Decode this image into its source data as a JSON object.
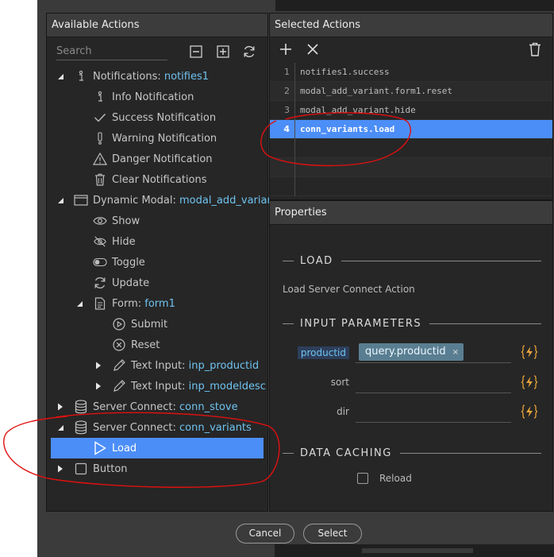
{
  "available": {
    "title": "Available Actions",
    "search_placeholder": "Search",
    "tree": [
      {
        "level": 0,
        "arrow": "down",
        "icon": "info-icon",
        "label": "Notifications: ",
        "value": "notifies1"
      },
      {
        "level": 1,
        "arrow": "none",
        "icon": "info-icon",
        "label": "Info Notification",
        "value": ""
      },
      {
        "level": 1,
        "arrow": "none",
        "icon": "check-icon",
        "label": "Success Notification",
        "value": ""
      },
      {
        "level": 1,
        "arrow": "none",
        "icon": "exclamation-icon",
        "label": "Warning Notification",
        "value": ""
      },
      {
        "level": 1,
        "arrow": "none",
        "icon": "warning-triangle-icon",
        "label": "Danger Notification",
        "value": ""
      },
      {
        "level": 1,
        "arrow": "none",
        "icon": "trash-icon",
        "label": "Clear Notifications",
        "value": ""
      },
      {
        "level": 0,
        "arrow": "down",
        "icon": "modal-window-icon",
        "label": "Dynamic Modal: ",
        "value": "modal_add_variant"
      },
      {
        "level": 1,
        "arrow": "none",
        "icon": "eye-icon",
        "label": "Show",
        "value": ""
      },
      {
        "level": 1,
        "arrow": "none",
        "icon": "eye-slash-icon",
        "label": "Hide",
        "value": ""
      },
      {
        "level": 1,
        "arrow": "none",
        "icon": "toggle-icon",
        "label": "Toggle",
        "value": ""
      },
      {
        "level": 1,
        "arrow": "none",
        "icon": "refresh-icon",
        "label": "Update",
        "value": ""
      },
      {
        "level": 1,
        "arrow": "down",
        "icon": "form-document-icon",
        "label": "Form: ",
        "value": "form1"
      },
      {
        "level": 2,
        "arrow": "none",
        "icon": "play-circle-icon",
        "label": "Submit",
        "value": ""
      },
      {
        "level": 2,
        "arrow": "none",
        "icon": "x-circle-icon",
        "label": "Reset",
        "value": ""
      },
      {
        "level": 2,
        "arrow": "right",
        "icon": "pencil-icon",
        "label": "Text Input: ",
        "value": "inp_productid"
      },
      {
        "level": 2,
        "arrow": "right",
        "icon": "pencil-icon",
        "label": "Text Input: ",
        "value": "inp_modeldesc"
      },
      {
        "level": 0,
        "arrow": "right",
        "icon": "database-icon",
        "label": "Server Connect: ",
        "value": "conn_stove"
      },
      {
        "level": 0,
        "arrow": "down",
        "icon": "database-icon",
        "label": "Server Connect: ",
        "value": "conn_variants"
      },
      {
        "level": 1,
        "arrow": "none",
        "icon": "play-outline-icon",
        "label": "Load",
        "value": "",
        "selected": true
      },
      {
        "level": 0,
        "arrow": "right",
        "icon": "button-square-icon",
        "label": "Button",
        "value": ""
      }
    ]
  },
  "selected": {
    "title": "Selected Actions",
    "items": [
      {
        "num": "1",
        "text": "notifies1.success",
        "active": false
      },
      {
        "num": "2",
        "text": "modal_add_variant.form1.reset",
        "active": false
      },
      {
        "num": "3",
        "text": "modal_add_variant.hide",
        "active": false
      },
      {
        "num": "4",
        "text": "conn_variants.load",
        "active": true
      },
      {
        "num": "",
        "text": "",
        "active": false
      },
      {
        "num": "",
        "text": "",
        "active": false
      },
      {
        "num": "",
        "text": "",
        "active": false
      }
    ]
  },
  "properties": {
    "title": "Properties",
    "section_load": "LOAD",
    "description": "Load Server Connect Action",
    "section_params": "INPUT PARAMETERS",
    "params": [
      {
        "name": "productid",
        "chip": "query.productid",
        "highlight": true
      },
      {
        "name": "sort",
        "chip": "",
        "highlight": false
      },
      {
        "name": "dir",
        "chip": "",
        "highlight": false
      }
    ],
    "chip_remove": "×",
    "section_caching": "DATA CACHING",
    "reload_label": "Reload"
  },
  "footer": {
    "cancel_label": "Cancel",
    "select_label": "Select"
  },
  "colors": {
    "accent": "#4c8ef7",
    "value_text": "#6fc3f0",
    "bolt": "#e8a33a",
    "annotation": "#e01010"
  }
}
